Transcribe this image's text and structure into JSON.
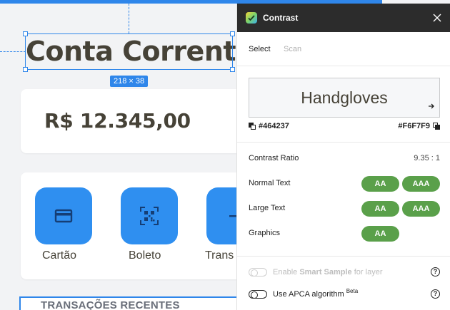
{
  "canvas": {
    "title": "Conta Corrente",
    "selection_size": "218 × 38",
    "balance": "R$ 12.345,00",
    "actions": [
      {
        "label": "Cartão",
        "icon": "credit-card-icon"
      },
      {
        "label": "Boleto",
        "icon": "qr-code-icon"
      },
      {
        "label": "Trans",
        "icon": "transfer-icon"
      }
    ],
    "section_title": "TRANSAÇÕES RECENTES",
    "accent_color": "#2f86ea"
  },
  "panel": {
    "title": "Contrast",
    "tabs": [
      {
        "label": "Select",
        "active": true
      },
      {
        "label": "Scan",
        "active": false
      }
    ],
    "preview_text": "Handgloves",
    "foreground_hex": "#464237",
    "background_hex": "#F6F7F9",
    "contrast_ratio_label": "Contrast Ratio",
    "contrast_ratio_value": "9.35 : 1",
    "checks": [
      {
        "label": "Normal Text",
        "badges": [
          "AA",
          "AAA"
        ]
      },
      {
        "label": "Large Text",
        "badges": [
          "AA",
          "AAA"
        ]
      },
      {
        "label": "Graphics",
        "badges": [
          "AA"
        ]
      }
    ],
    "pass_color": "#5aa04a",
    "options": {
      "smart_sample": {
        "prefix": "Enable ",
        "bold": "Smart Sample",
        "suffix": " for layer",
        "help": "?"
      },
      "apca": {
        "text": "Use APCA algorithm",
        "sup": "Beta",
        "help": "?"
      }
    }
  }
}
